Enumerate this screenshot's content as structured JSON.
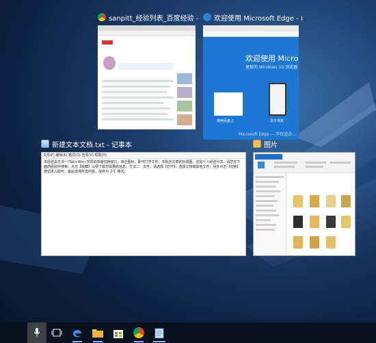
{
  "windows": {
    "chrome": {
      "title": "sanpitt_经验列表_百度经验 - Goo...",
      "icon": "chrome-icon"
    },
    "edge": {
      "title": "欢迎使用 Microsoft Edge - Micro...",
      "icon": "edge-icon",
      "welcome_heading": "欢迎使用 Microsoft E",
      "welcome_sub": "更新的 Windows 10 浏览器",
      "card_left_caption": "使用页面上",
      "card_right_caption": "关于浏览",
      "footer": "Microsoft Edge — 不仅适合..."
    },
    "notepad": {
      "title": "新建文本文档.txt - 记事本",
      "icon": "notepad-icon",
      "menu": "文件(F)  编辑(E)  格式(O)  查看(V)  帮助(H)",
      "body": "本经验由方法一(Tab+Win) 实现的快速切换窗口。单击图标，即可打开文件。本批示文章的标题图，这是个人经验分享。请您在下面的经验中搜索，点击【收藏】以便下载您需要的信息。方法二：文件，请选择【打开】，选择文档或其他文件。另外点击【切换】按钮进入即可。最后选择所需内容，保存为【*】格式。"
    },
    "photos": {
      "title": "图片",
      "icon": "photos-icon"
    }
  },
  "taskbar": {
    "apps": [
      {
        "name": "edge",
        "state": "running"
      },
      {
        "name": "file-explorer",
        "state": "running"
      },
      {
        "name": "store",
        "state": "normal"
      },
      {
        "name": "chrome",
        "state": "running"
      },
      {
        "name": "notepad",
        "state": "running"
      }
    ]
  },
  "colors": {
    "edge_blue": "#1f77d4",
    "taskbar": "#0a1220",
    "accent": "#8ab4e8"
  }
}
